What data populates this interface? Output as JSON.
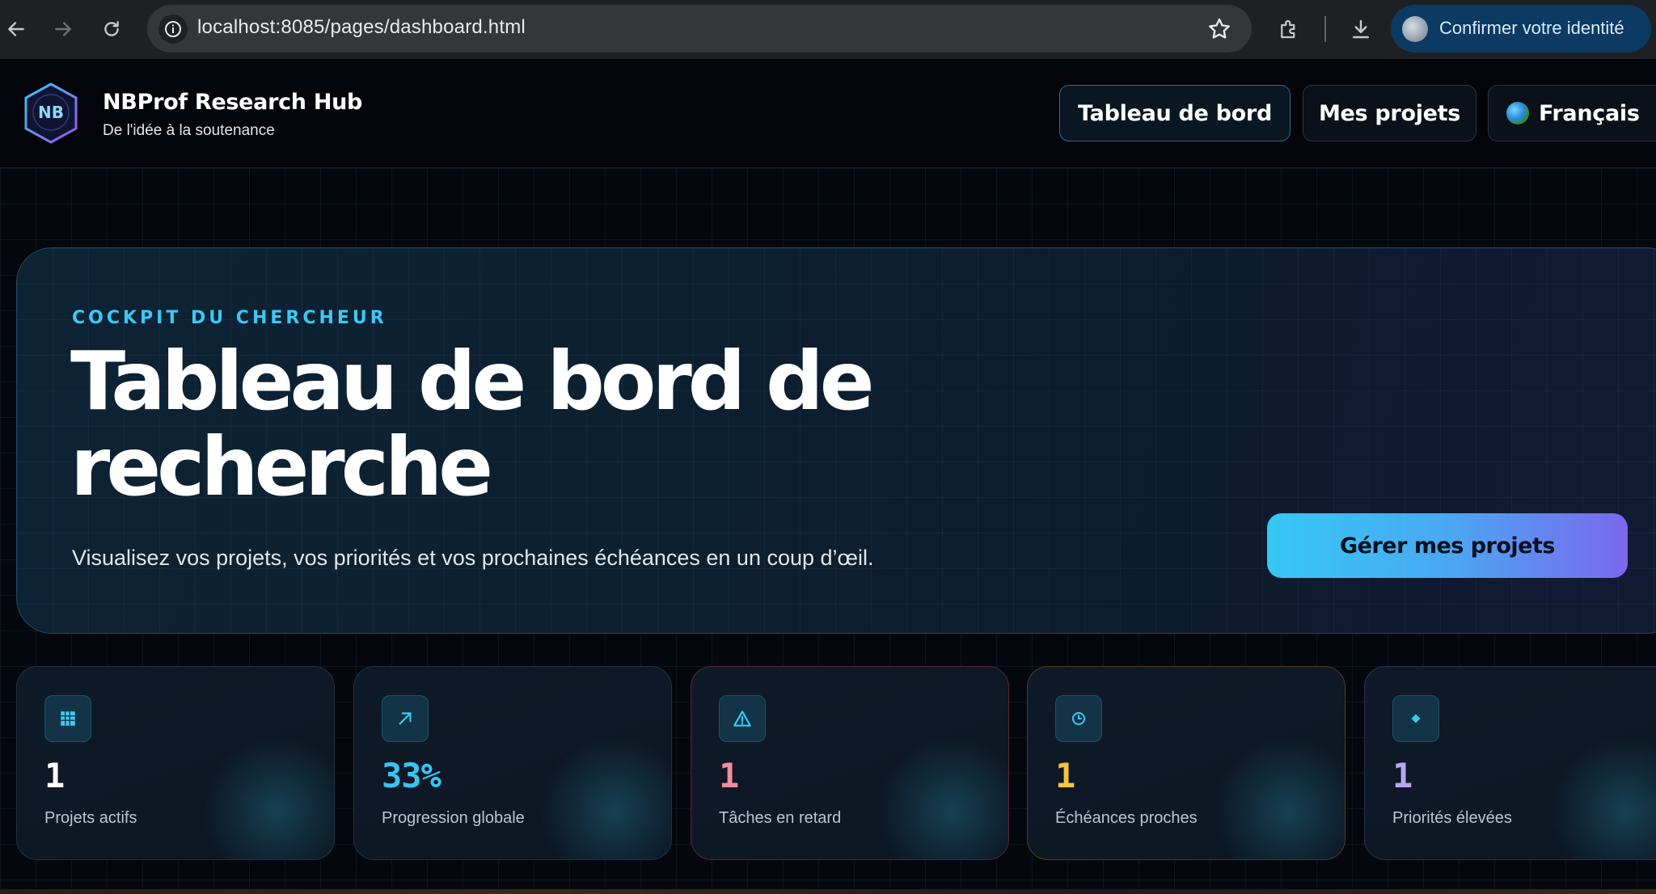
{
  "browser": {
    "url": "localhost:8085/pages/dashboard.html",
    "identity_label": "Confirmer votre identité"
  },
  "header": {
    "brand_title": "NBProf Research Hub",
    "brand_subtitle": "De l'idée à la soutenance",
    "logo_text": "NB",
    "nav": {
      "dashboard": "Tableau de bord",
      "projects": "Mes projets",
      "language": "Français"
    }
  },
  "hero": {
    "eyebrow": "Cockpit du chercheur",
    "title": "Tableau de bord de recherche",
    "description": "Visualisez vos projets, vos priorités et vos prochaines échéances en un coup d’œil.",
    "cta": "Gérer mes projets"
  },
  "stats": [
    {
      "value": "1",
      "label": "Projets actifs",
      "icon": "grid-icon",
      "color": "#ffffff",
      "border": "#1f3246"
    },
    {
      "value": "33%",
      "label": "Progression globale",
      "icon": "trend-arrow-icon",
      "color": "#38c4f2",
      "border": "#1f3246"
    },
    {
      "value": "1",
      "label": "Tâches en retard",
      "icon": "warning-icon",
      "color": "#f28da0",
      "border": "#5a2433"
    },
    {
      "value": "1",
      "label": "Échéances proches",
      "icon": "clock-icon",
      "color": "#f4c542",
      "border": "#4e3e18"
    },
    {
      "value": "1",
      "label": "Priorités élevées",
      "icon": "diamond-icon",
      "color": "#b9a4f5",
      "border": "#2c2f52"
    }
  ],
  "colors": {
    "accent_cyan": "#3cc8f5",
    "accent_purple": "#7b67ee",
    "background": "#04080e"
  }
}
